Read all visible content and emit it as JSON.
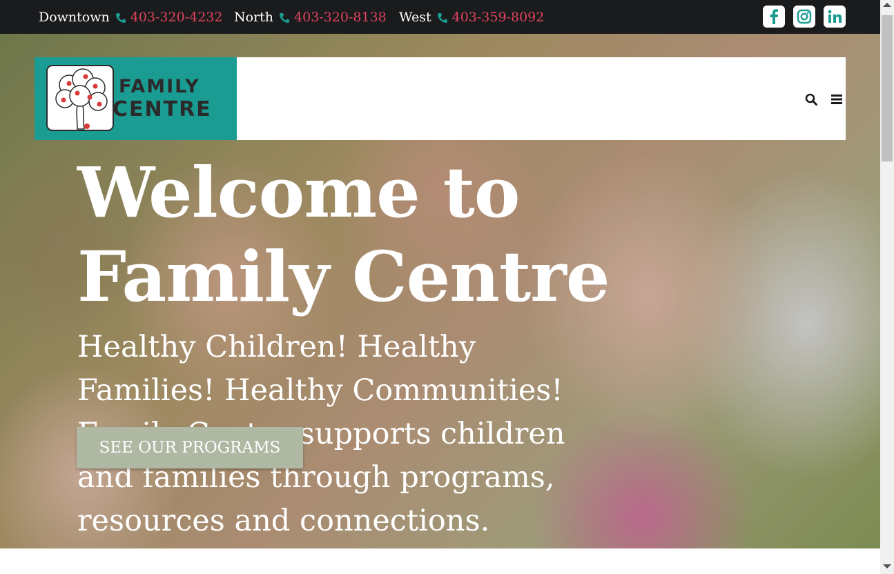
{
  "topbar": {
    "contacts": [
      {
        "location": "Downtown",
        "phone": "403-320-4232"
      },
      {
        "location": "North",
        "phone": "403-320-8138"
      },
      {
        "location": "West",
        "phone": "403-359-8092"
      }
    ],
    "social": [
      {
        "icon": "facebook-icon"
      },
      {
        "icon": "instagram-icon"
      },
      {
        "icon": "linkedin-icon"
      }
    ]
  },
  "header": {
    "logo_line1": "FAMILY",
    "logo_line2": "CENTRE"
  },
  "hero": {
    "title_line1": "Welcome to",
    "title_line2": "Family Centre",
    "subtitle": "Healthy Children! Healthy Families! Healthy Communities! Family Centre supports children and families through programs, resources and connections.",
    "cta_label": "SEE OUR PROGRAMS"
  },
  "colors": {
    "topbar_bg": "#1a1b1d",
    "accent_teal": "#1a9c93",
    "phone_red": "#e0445e",
    "cta_bg": "#aeb8a3"
  }
}
